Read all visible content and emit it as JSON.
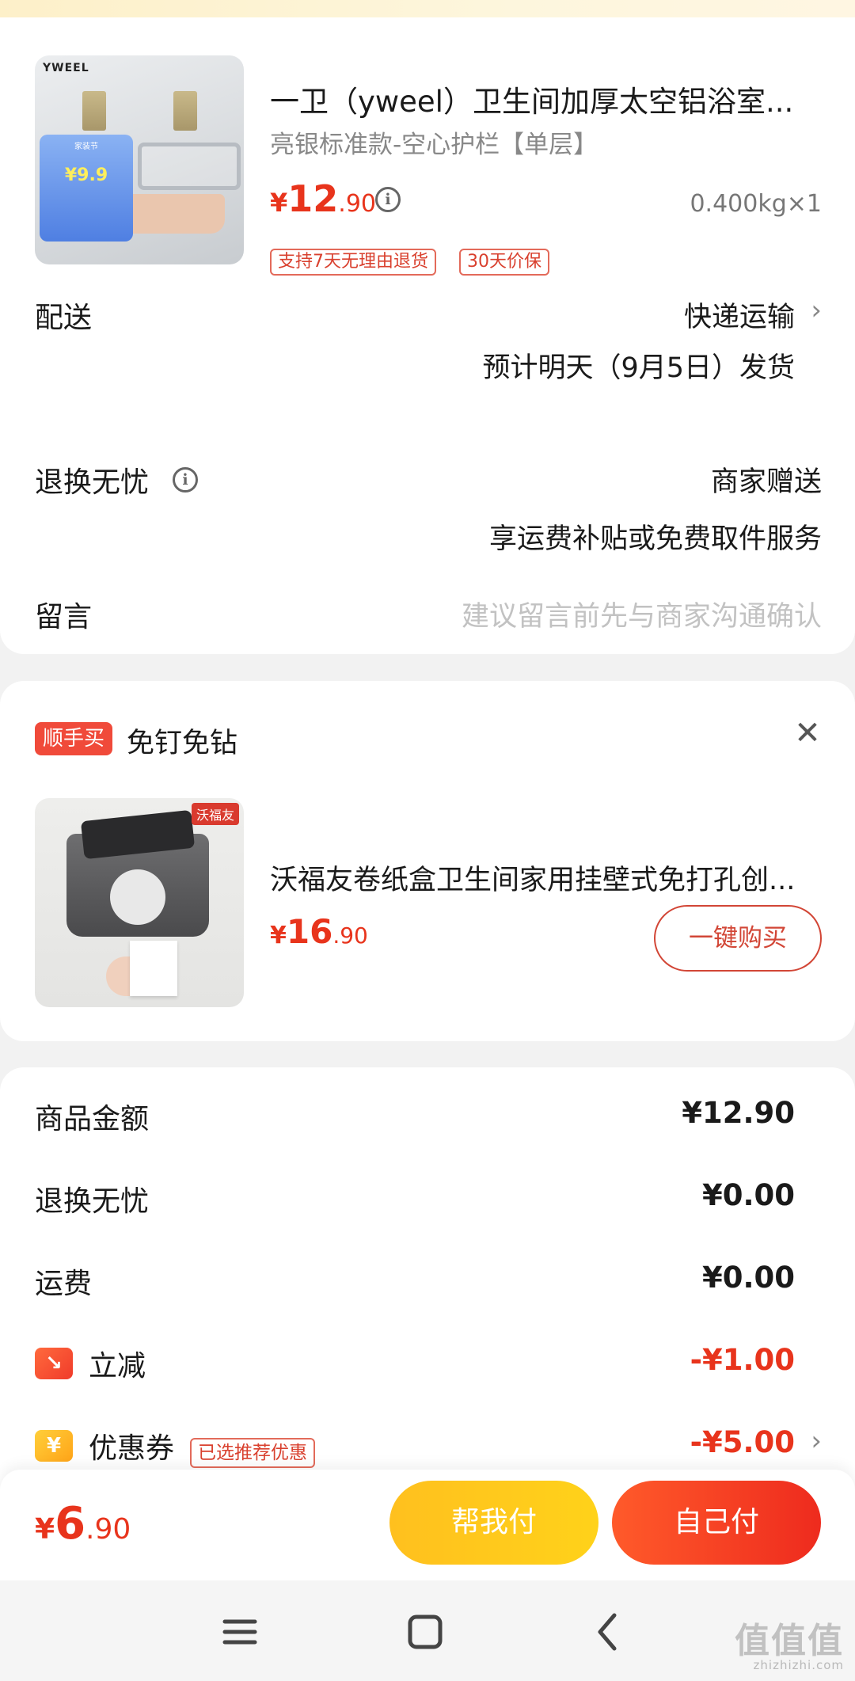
{
  "order_item": {
    "brand": "YWEEL",
    "promo_badge": "家装节",
    "promo_price": "¥9.9",
    "title": "一卫（yweel）卫生间加厚太空铝浴室...",
    "spec": "亮银标准款-空心护栏【单层】",
    "price": {
      "currency": "¥",
      "int": "12",
      "dec": ".90"
    },
    "weight": "0.400kg×1",
    "tags": [
      "支持7天无理由退货",
      "30天价保"
    ]
  },
  "delivery": {
    "label": "配送",
    "method": "快递运输",
    "eta": "预计明天（9月5日）发货"
  },
  "return_worry_free": {
    "label": "退换无忧",
    "value": "商家赠送",
    "desc": "享运费补贴或免费取件服务"
  },
  "message": {
    "label": "留言",
    "placeholder": "建议留言前先与商家沟通确认"
  },
  "addon": {
    "badge": "顺手买",
    "title": "免钉免钻",
    "brand_tag": "沃福友",
    "name": "沃福友卷纸盒卫生间家用挂壁式免打孔创...",
    "price": {
      "currency": "¥",
      "int": "16",
      "dec": ".90"
    },
    "buy_label": "一键购买"
  },
  "summary": {
    "goods_label": "商品金额",
    "goods_value": "¥12.90",
    "return_label": "退换无忧",
    "return_value": "¥0.00",
    "shipping_label": "运费",
    "shipping_value": "¥0.00",
    "discount_label": "立减",
    "discount_value": "-¥1.00",
    "coupon_label": "优惠券",
    "coupon_tag": "已选推荐优惠",
    "coupon_value": "-¥5.00"
  },
  "checkout": {
    "total": {
      "currency": "¥",
      "int": "6",
      "dec": ".90"
    },
    "help_pay": "帮我付",
    "self_pay": "自己付"
  },
  "watermark": {
    "text": "值值值",
    "sub": "zhizhizhi.com"
  },
  "icons": {
    "info": "info-icon",
    "chevron": "chevron-right-icon",
    "close": "close-icon",
    "discount": "trend-down-icon",
    "coupon": "yen-icon",
    "nav": [
      "menu-icon",
      "home-icon",
      "back-icon"
    ]
  },
  "colors": {
    "accent_red": "#e8341c",
    "accent_yellow": "#ffc01e"
  }
}
